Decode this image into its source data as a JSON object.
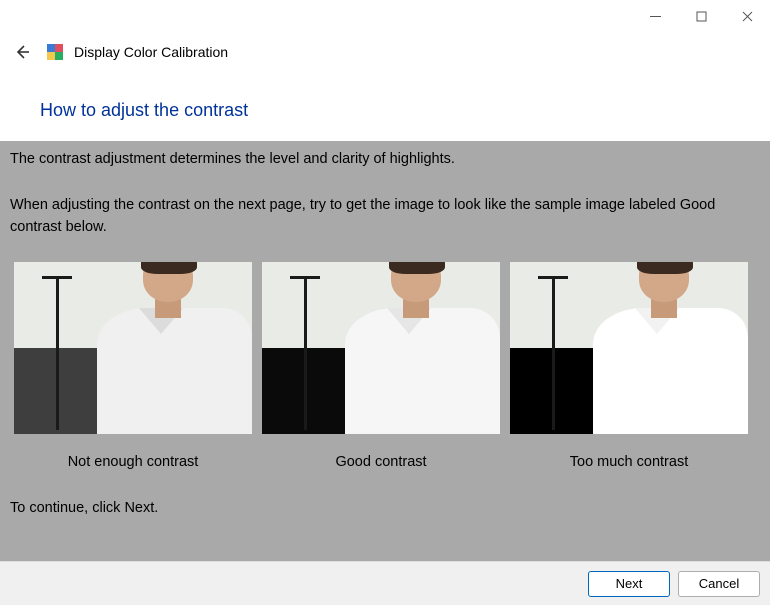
{
  "window": {
    "app_title": "Display Color Calibration"
  },
  "page": {
    "heading": "How to adjust the contrast",
    "intro_line": "The contrast adjustment determines the level and clarity of highlights.",
    "instruction_line": "When adjusting the contrast on the next page, try to get the image to look like the sample image labeled Good contrast below.",
    "continue_line": "To continue, click Next."
  },
  "samples": [
    {
      "caption": "Not enough contrast"
    },
    {
      "caption": "Good contrast"
    },
    {
      "caption": "Too much contrast"
    }
  ],
  "footer": {
    "primary_label": "Next",
    "cancel_label": "Cancel"
  },
  "icons": {
    "back": "back-arrow-icon",
    "app": "color-calibration-icon",
    "minimize": "minimize-icon",
    "maximize": "maximize-icon",
    "close": "close-icon"
  }
}
